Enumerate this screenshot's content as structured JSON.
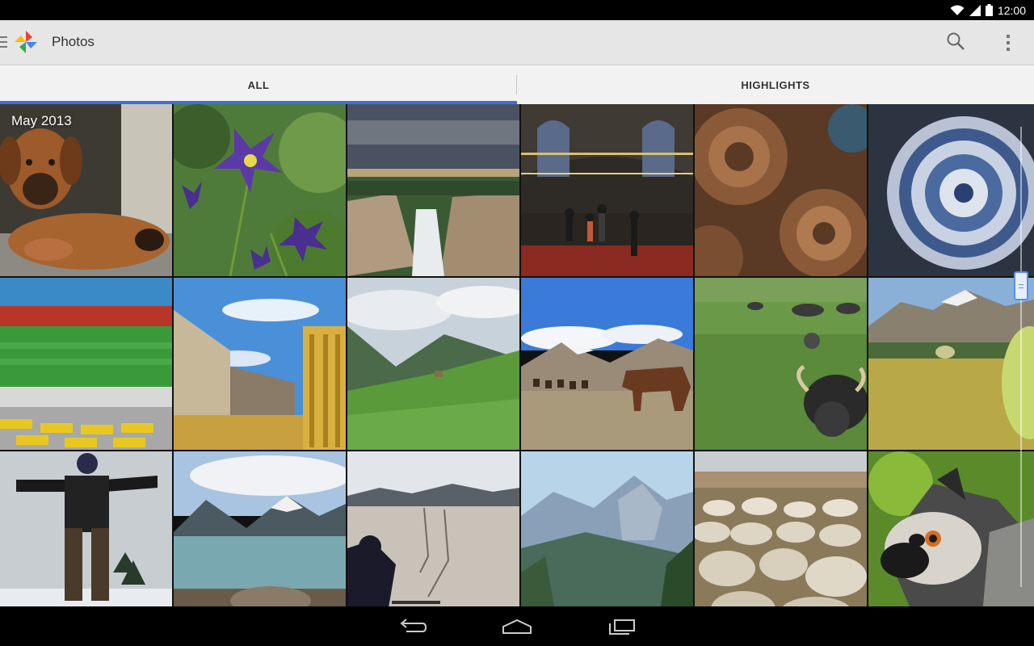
{
  "status_bar": {
    "time": "12:00"
  },
  "app": {
    "title": "Photos"
  },
  "tabs": [
    {
      "label": "ALL",
      "selected": true
    },
    {
      "label": "HIGHLIGHTS",
      "selected": false
    }
  ],
  "grid": {
    "section_label": "May 2013",
    "photos": [
      {
        "name": "photo-puppy"
      },
      {
        "name": "photo-purple-flowers"
      },
      {
        "name": "photo-waterfall-canyon"
      },
      {
        "name": "photo-mosque-interior"
      },
      {
        "name": "photo-mosque-domes"
      },
      {
        "name": "photo-dome-ceiling"
      },
      {
        "name": "photo-stadium"
      },
      {
        "name": "photo-palace-gate"
      },
      {
        "name": "photo-mountain-valley"
      },
      {
        "name": "photo-horses-mountains"
      },
      {
        "name": "photo-water-buffalo"
      },
      {
        "name": "photo-mountain-meadow"
      },
      {
        "name": "photo-snowboarder"
      },
      {
        "name": "photo-glacier-lake"
      },
      {
        "name": "photo-desert-playa"
      },
      {
        "name": "photo-half-dome"
      },
      {
        "name": "photo-sheep-flock"
      },
      {
        "name": "photo-lemur"
      }
    ]
  },
  "colors": {
    "accent": "#3d6fd9",
    "action_bar": "#e6e6e6",
    "tab_bar": "#f2f2f2"
  },
  "icons": [
    "menu-icon",
    "photos-logo-icon",
    "search-icon",
    "overflow-menu-icon",
    "wifi-icon",
    "signal-icon",
    "battery-icon",
    "back-icon",
    "home-icon",
    "recents-icon"
  ]
}
